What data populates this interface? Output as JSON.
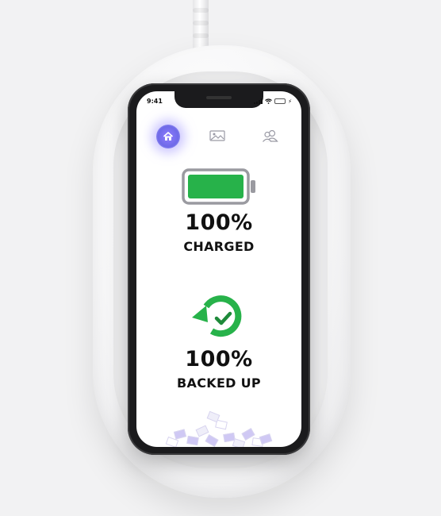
{
  "status_bar": {
    "time": "9:41"
  },
  "nav": {
    "home_icon": "home-icon",
    "gallery_icon": "gallery-icon",
    "people_icon": "people-icon"
  },
  "battery": {
    "percent_label": "100%",
    "status_label": "CHARGED",
    "level": 1.0
  },
  "backup": {
    "percent_label": "100%",
    "status_label": "BACKED UP"
  },
  "colors": {
    "accent_green": "#27b24a",
    "home_glow": "#7f74f0"
  }
}
